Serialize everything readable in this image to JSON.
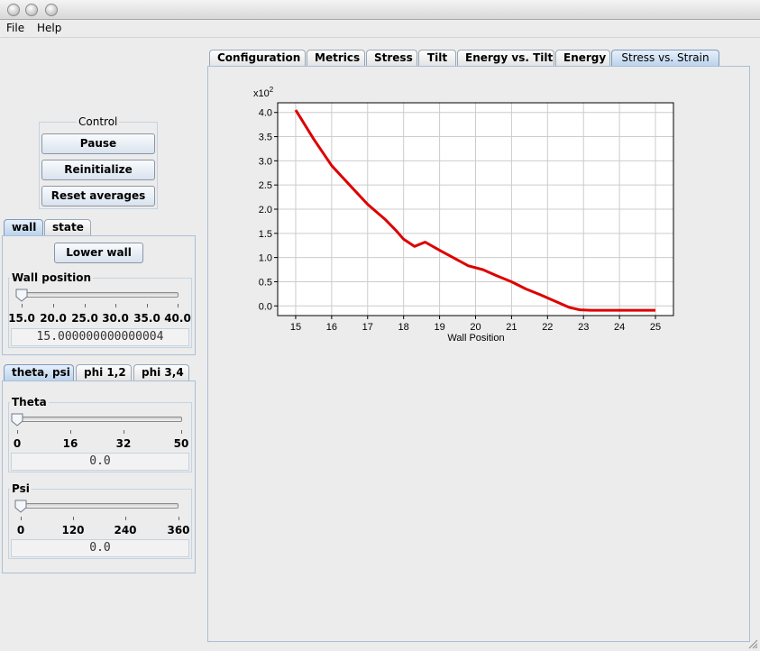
{
  "menu": {
    "file": "File",
    "help": "Help"
  },
  "control": {
    "legend": "Control",
    "pause": "Pause",
    "reinitialize": "Reinitialize",
    "reset_averages": "Reset averages"
  },
  "wall_tabs": {
    "wall": "wall",
    "state": "state"
  },
  "wall": {
    "lower_wall": "Lower wall",
    "position_legend": "Wall position",
    "ticks": [
      "15.0",
      "20.0",
      "25.0",
      "30.0",
      "35.0",
      "40.0"
    ],
    "value": "15.000000000000004",
    "slider_fraction": 0.0
  },
  "angle_tabs": {
    "theta_psi": "theta, psi",
    "phi12": "phi 1,2",
    "phi34": "phi 3,4"
  },
  "theta": {
    "legend": "Theta",
    "ticks": [
      "0",
      "16",
      "32",
      "50"
    ],
    "value": "0.0",
    "slider_fraction": 0.0
  },
  "psi": {
    "legend": "Psi",
    "ticks": [
      "0",
      "120",
      "240",
      "360"
    ],
    "value": "0.0",
    "slider_fraction": 0.0
  },
  "main_tabs": [
    "Configuration",
    "Metrics",
    "Stress",
    "Tilt",
    "Energy vs. Tilt",
    "Energy",
    "Stress vs. Strain"
  ],
  "active_tab": "Stress vs. Strain",
  "chart_data": {
    "type": "line",
    "xlabel": "Wall Position",
    "ylabel": "",
    "y_multiplier": "x10",
    "y_multiplier_exp": "2",
    "xlim": [
      14.5,
      25.5
    ],
    "ylim": [
      -0.2,
      4.2
    ],
    "x_ticks": [
      "15",
      "16",
      "17",
      "18",
      "19",
      "20",
      "21",
      "22",
      "23",
      "24",
      "25"
    ],
    "y_ticks": [
      "0.0",
      "0.5",
      "1.0",
      "1.5",
      "2.0",
      "2.5",
      "3.0",
      "3.5",
      "4.0"
    ],
    "grid": true,
    "color": "#dd0000",
    "series": [
      {
        "x": [
          15.0,
          15.5,
          16.0,
          16.5,
          17.0,
          17.5,
          17.8,
          18.0,
          18.3,
          18.6,
          19.0,
          19.5,
          19.8,
          20.2,
          20.6,
          21.0,
          21.4,
          21.8,
          22.2,
          22.6,
          22.9,
          23.2,
          24.0,
          25.0
        ],
        "y": [
          4.05,
          3.45,
          2.9,
          2.5,
          2.1,
          1.78,
          1.55,
          1.38,
          1.23,
          1.32,
          1.15,
          0.95,
          0.83,
          0.75,
          0.62,
          0.5,
          0.35,
          0.23,
          0.1,
          -0.03,
          -0.08,
          -0.09,
          -0.09,
          -0.09
        ]
      }
    ]
  }
}
